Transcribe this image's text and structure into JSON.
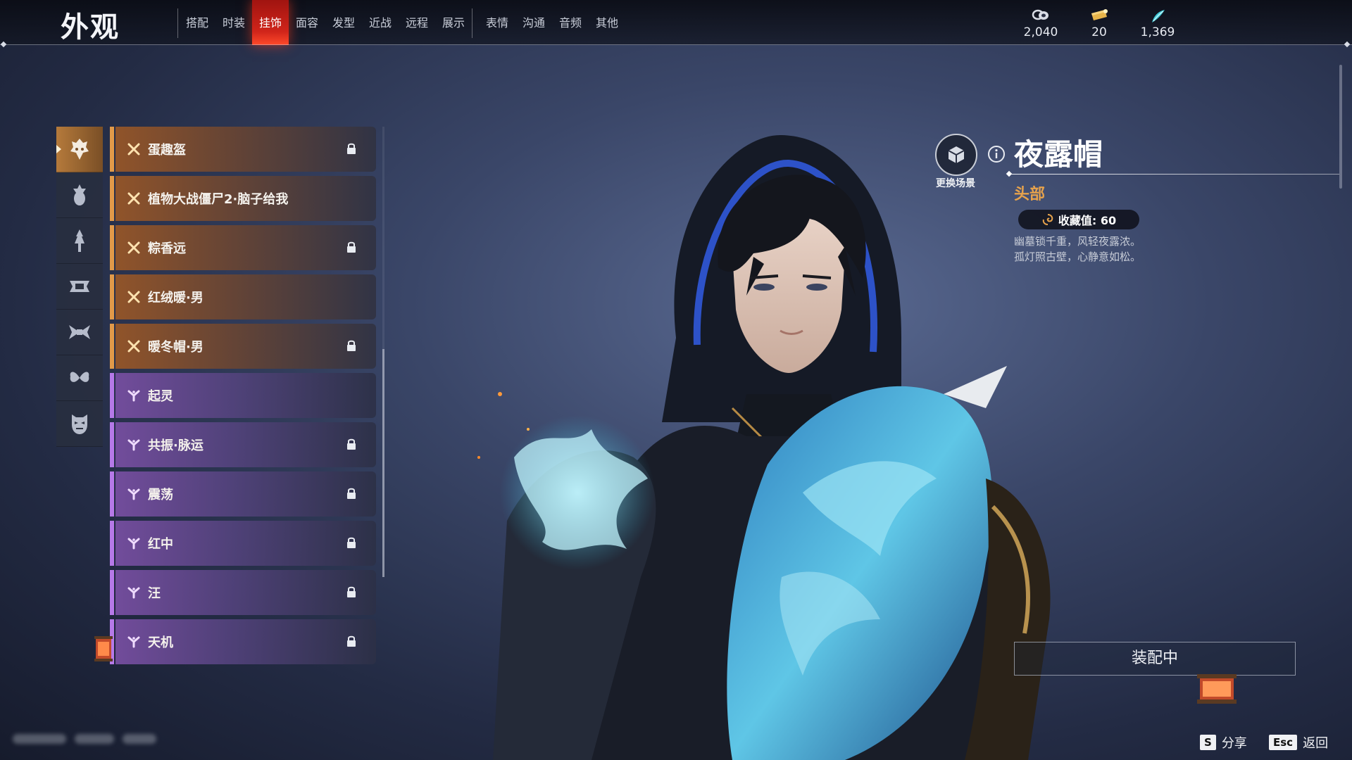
{
  "header": {
    "title": "外观",
    "tabs": [
      {
        "label": "搭配",
        "active": false
      },
      {
        "label": "时装",
        "active": false
      },
      {
        "label": "挂饰",
        "active": true
      },
      {
        "label": "面容",
        "active": false
      },
      {
        "label": "发型",
        "active": false
      },
      {
        "label": "近战",
        "active": false
      },
      {
        "label": "远程",
        "active": false
      },
      {
        "label": "展示",
        "active": false
      },
      {
        "label": "表情",
        "active": false
      },
      {
        "label": "沟通",
        "active": false
      },
      {
        "label": "音频",
        "active": false
      },
      {
        "label": "其他",
        "active": false
      }
    ],
    "currencies": [
      {
        "icon": "coin-stack-icon",
        "value": "2,040"
      },
      {
        "icon": "gold-ticket-icon",
        "value": "20"
      },
      {
        "icon": "jade-feather-icon",
        "value": "1,369"
      }
    ]
  },
  "categories": [
    {
      "icon": "head-ornament-icon",
      "active": true
    },
    {
      "icon": "face-ornament-icon",
      "active": false
    },
    {
      "icon": "back-ornament-icon",
      "active": false
    },
    {
      "icon": "waist-ornament-icon",
      "active": false
    },
    {
      "icon": "wing-ornament-icon",
      "active": false
    },
    {
      "icon": "butterfly-ornament-icon",
      "active": false
    },
    {
      "icon": "mask-ornament-icon",
      "active": false
    }
  ],
  "items": [
    {
      "name": "蛋趣盔",
      "rarity": "orange",
      "locked": true
    },
    {
      "name": "植物大战僵尸2·脑子给我",
      "rarity": "orange",
      "locked": false
    },
    {
      "name": "粽香远",
      "rarity": "orange",
      "locked": true
    },
    {
      "name": "红绒暖·男",
      "rarity": "orange",
      "locked": false
    },
    {
      "name": "暖冬帽·男",
      "rarity": "orange",
      "locked": true
    },
    {
      "name": "起灵",
      "rarity": "purple",
      "locked": false
    },
    {
      "name": "共振·脉运",
      "rarity": "purple",
      "locked": true
    },
    {
      "name": "震荡",
      "rarity": "purple",
      "locked": true
    },
    {
      "name": "红中",
      "rarity": "purple",
      "locked": true
    },
    {
      "name": "汪",
      "rarity": "purple",
      "locked": true
    },
    {
      "name": "天机",
      "rarity": "purple",
      "locked": true
    }
  ],
  "detail": {
    "scene_button_label": "更换场景",
    "title": "夜露帽",
    "slot": "头部",
    "collection_label": "收藏值: 60",
    "description_lines": [
      "幽墓锁千重，风轻夜露浓。",
      "孤灯照古壁，心静意如松。"
    ],
    "status": "装配中"
  },
  "hints": {
    "share_key": "S",
    "share_label": "分享",
    "back_key": "Esc",
    "back_label": "返回"
  },
  "colors": {
    "accent_orange": "#e29a49",
    "accent_purple": "#b679e8",
    "active_tab_red": "#d0241a",
    "slot_gold": "#e6a24c"
  }
}
